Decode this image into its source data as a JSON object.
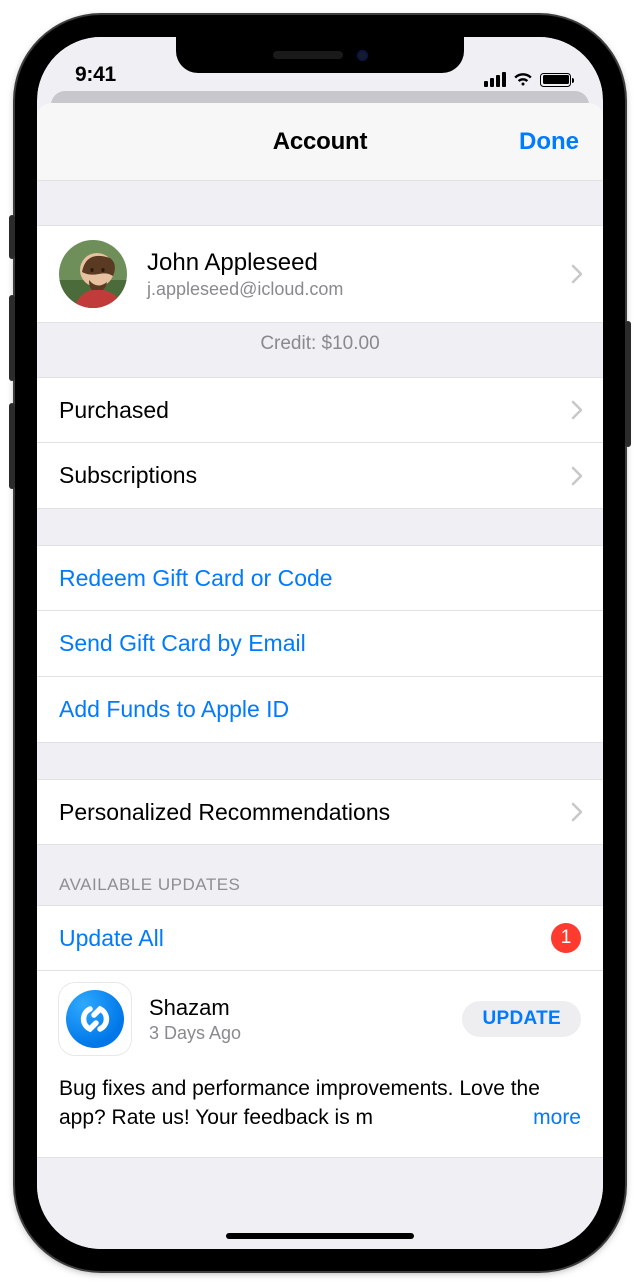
{
  "status": {
    "time": "9:41"
  },
  "nav": {
    "title": "Account",
    "done": "Done"
  },
  "profile": {
    "name": "John Appleseed",
    "email": "j.appleseed@icloud.com"
  },
  "credit": {
    "label": "Credit: $10.00"
  },
  "menu": {
    "purchased": "Purchased",
    "subscriptions": "Subscriptions",
    "redeem": "Redeem Gift Card or Code",
    "send_gift": "Send Gift Card by Email",
    "add_funds": "Add Funds to Apple ID",
    "recommendations": "Personalized Recommendations"
  },
  "updates": {
    "section_header": "Available Updates",
    "update_all": "Update All",
    "badge_count": "1",
    "app": {
      "name": "Shazam",
      "subtitle": "3 Days Ago",
      "button": "UPDATE",
      "description": "Bug fixes and performance improvements. Love the app? Rate us! Your feedback is m",
      "more": "more"
    }
  }
}
